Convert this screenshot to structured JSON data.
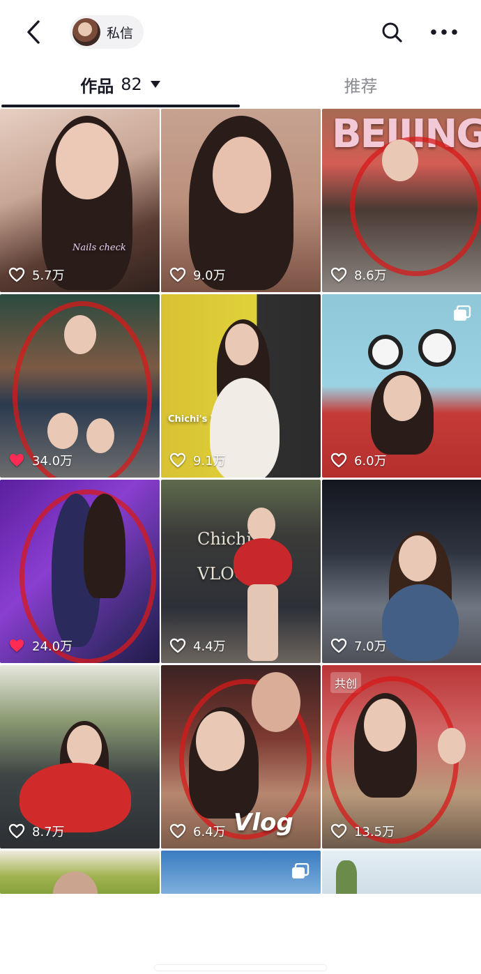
{
  "header": {
    "dm_label": "私信"
  },
  "tabs": {
    "works_label": "作品",
    "works_count": "82",
    "recommend_label": "推荐"
  },
  "grid": {
    "items": [
      {
        "likes": "5.7万",
        "liked": false,
        "overlay": "Nails check"
      },
      {
        "likes": "9.0万",
        "liked": false
      },
      {
        "likes": "8.6万",
        "liked": false,
        "overlay": "BEIJING"
      },
      {
        "likes": "34.0万",
        "liked": true
      },
      {
        "likes": "9.1万",
        "liked": false,
        "overlay": "Chichi's VLOG"
      },
      {
        "likes": "6.0万",
        "liked": false,
        "multi": true
      },
      {
        "likes": "24.0万",
        "liked": true
      },
      {
        "likes": "4.4万",
        "liked": false,
        "overlay": "Chichi's VLOG"
      },
      {
        "likes": "7.0万",
        "liked": false
      },
      {
        "likes": "8.7万",
        "liked": false
      },
      {
        "likes": "6.4万",
        "liked": false,
        "overlay": "Vlog"
      },
      {
        "likes": "13.5万",
        "liked": false,
        "badge": "共创"
      }
    ]
  },
  "colors": {
    "accent_like": "#fe2c55",
    "text_primary": "#161823",
    "text_secondary": "#8a8b91"
  }
}
